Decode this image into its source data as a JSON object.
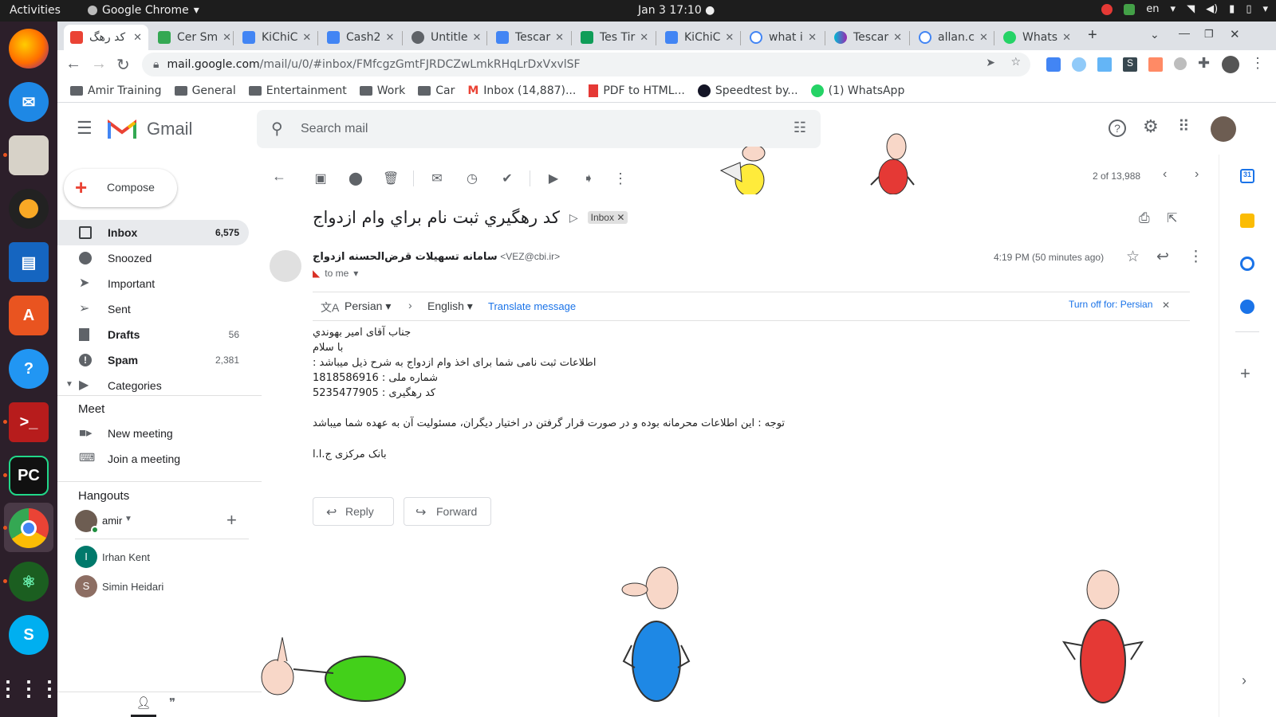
{
  "os": {
    "activities": "Activities",
    "app_name": "Google Chrome",
    "clock": "Jan 3  17:10",
    "lang": "en"
  },
  "chrome": {
    "tabs": [
      {
        "label": "کد رهگ",
        "fav_color": "#ea4335",
        "active": true
      },
      {
        "label": "Cer Sm",
        "fav_color": "#34a853"
      },
      {
        "label": "KiChiC",
        "fav_color": "#4285f4"
      },
      {
        "label": "Cash2",
        "fav_color": "#4285f4"
      },
      {
        "label": "Untitle",
        "fav_color": "#5f6368"
      },
      {
        "label": "Tescar",
        "fav_color": "#4285f4"
      },
      {
        "label": "Tes Tir",
        "fav_color": "#0f9d58"
      },
      {
        "label": "KiChiC",
        "fav_color": "#4285f4"
      },
      {
        "label": "what i",
        "fav_color": "#4285f4"
      },
      {
        "label": "Tescar",
        "fav_color": "#9c27b0"
      },
      {
        "label": "allan.c",
        "fav_color": "#4285f4"
      },
      {
        "label": "Whats",
        "fav_color": "#25d366"
      }
    ],
    "url_host": "mail.google.com",
    "url_path": "/mail/u/0/#inbox/FMfcgzGmtFJRDCZwLmkRHqLrDxVxvlSF",
    "bookmarks": [
      {
        "label": "Amir Training",
        "type": "folder"
      },
      {
        "label": "General",
        "type": "folder"
      },
      {
        "label": "Entertainment",
        "type": "folder"
      },
      {
        "label": "Work",
        "type": "folder"
      },
      {
        "label": "Car",
        "type": "folder"
      },
      {
        "label": "Inbox (14,887)...",
        "type": "gmail"
      },
      {
        "label": "PDF to HTML...",
        "type": "pdf"
      },
      {
        "label": "Speedtest by...",
        "type": "speed"
      },
      {
        "label": "(1) WhatsApp",
        "type": "whatsapp"
      }
    ]
  },
  "gmail": {
    "logo": "Gmail",
    "search_placeholder": "Search mail",
    "compose": "Compose",
    "nav": [
      {
        "label": "Inbox",
        "count": "6,575",
        "bold": true,
        "active": true,
        "icon": "inbox-icon"
      },
      {
        "label": "Snoozed",
        "count": "",
        "icon": "clock-icon"
      },
      {
        "label": "Important",
        "count": "",
        "icon": "important-icon"
      },
      {
        "label": "Sent",
        "count": "",
        "icon": "send-icon"
      },
      {
        "label": "Drafts",
        "count": "56",
        "bold": true,
        "icon": "draft-icon"
      },
      {
        "label": "Spam",
        "count": "2,381",
        "bold": true,
        "icon": "spam-icon"
      },
      {
        "label": "Categories",
        "count": "",
        "icon": "label-icon"
      }
    ],
    "meet": {
      "title": "Meet",
      "new_meeting": "New meeting",
      "join_meeting": "Join a meeting"
    },
    "hangouts": {
      "title": "Hangouts",
      "user": "amir",
      "contacts": [
        {
          "initial": "I",
          "name": "Irhan Kent",
          "color": "#00796b"
        },
        {
          "initial": "S",
          "name": "Simin Heidari",
          "color": "#8d6e63"
        }
      ]
    },
    "pager": "2 of 13,988",
    "subject": "کد رهگيري ثبت نام براي وام ازدواج",
    "label_chip": "Inbox",
    "sender_name": "سامانه تسهیلات قرض‌الحسنه ازدواج",
    "sender_email": "<VEZ@cbi.ir>",
    "to": "to me",
    "time": "4:19 PM (50 minutes ago)",
    "translate": {
      "from": "Persian",
      "to": "English",
      "link": "Translate message",
      "turn_off": "Turn off for: Persian"
    },
    "body": [
      "جناب آقای امير بهوندي",
      "با سلام",
      "اطلاعات ثبت نامی شما برای اخذ وام ازدواج به شرح ذيل ميباشد :",
      "شماره ملی : 1818586916",
      "کد رهگيری : 5235477905",
      "توجه : اين اطلاعات محرمانه بوده و در صورت قرار گرفتن در اختيار ديگران، مسئوليت آن به عهده شما ميباشد",
      "بانک مرکزی ج.ا.ا"
    ],
    "reply": "Reply",
    "forward": "Forward"
  }
}
